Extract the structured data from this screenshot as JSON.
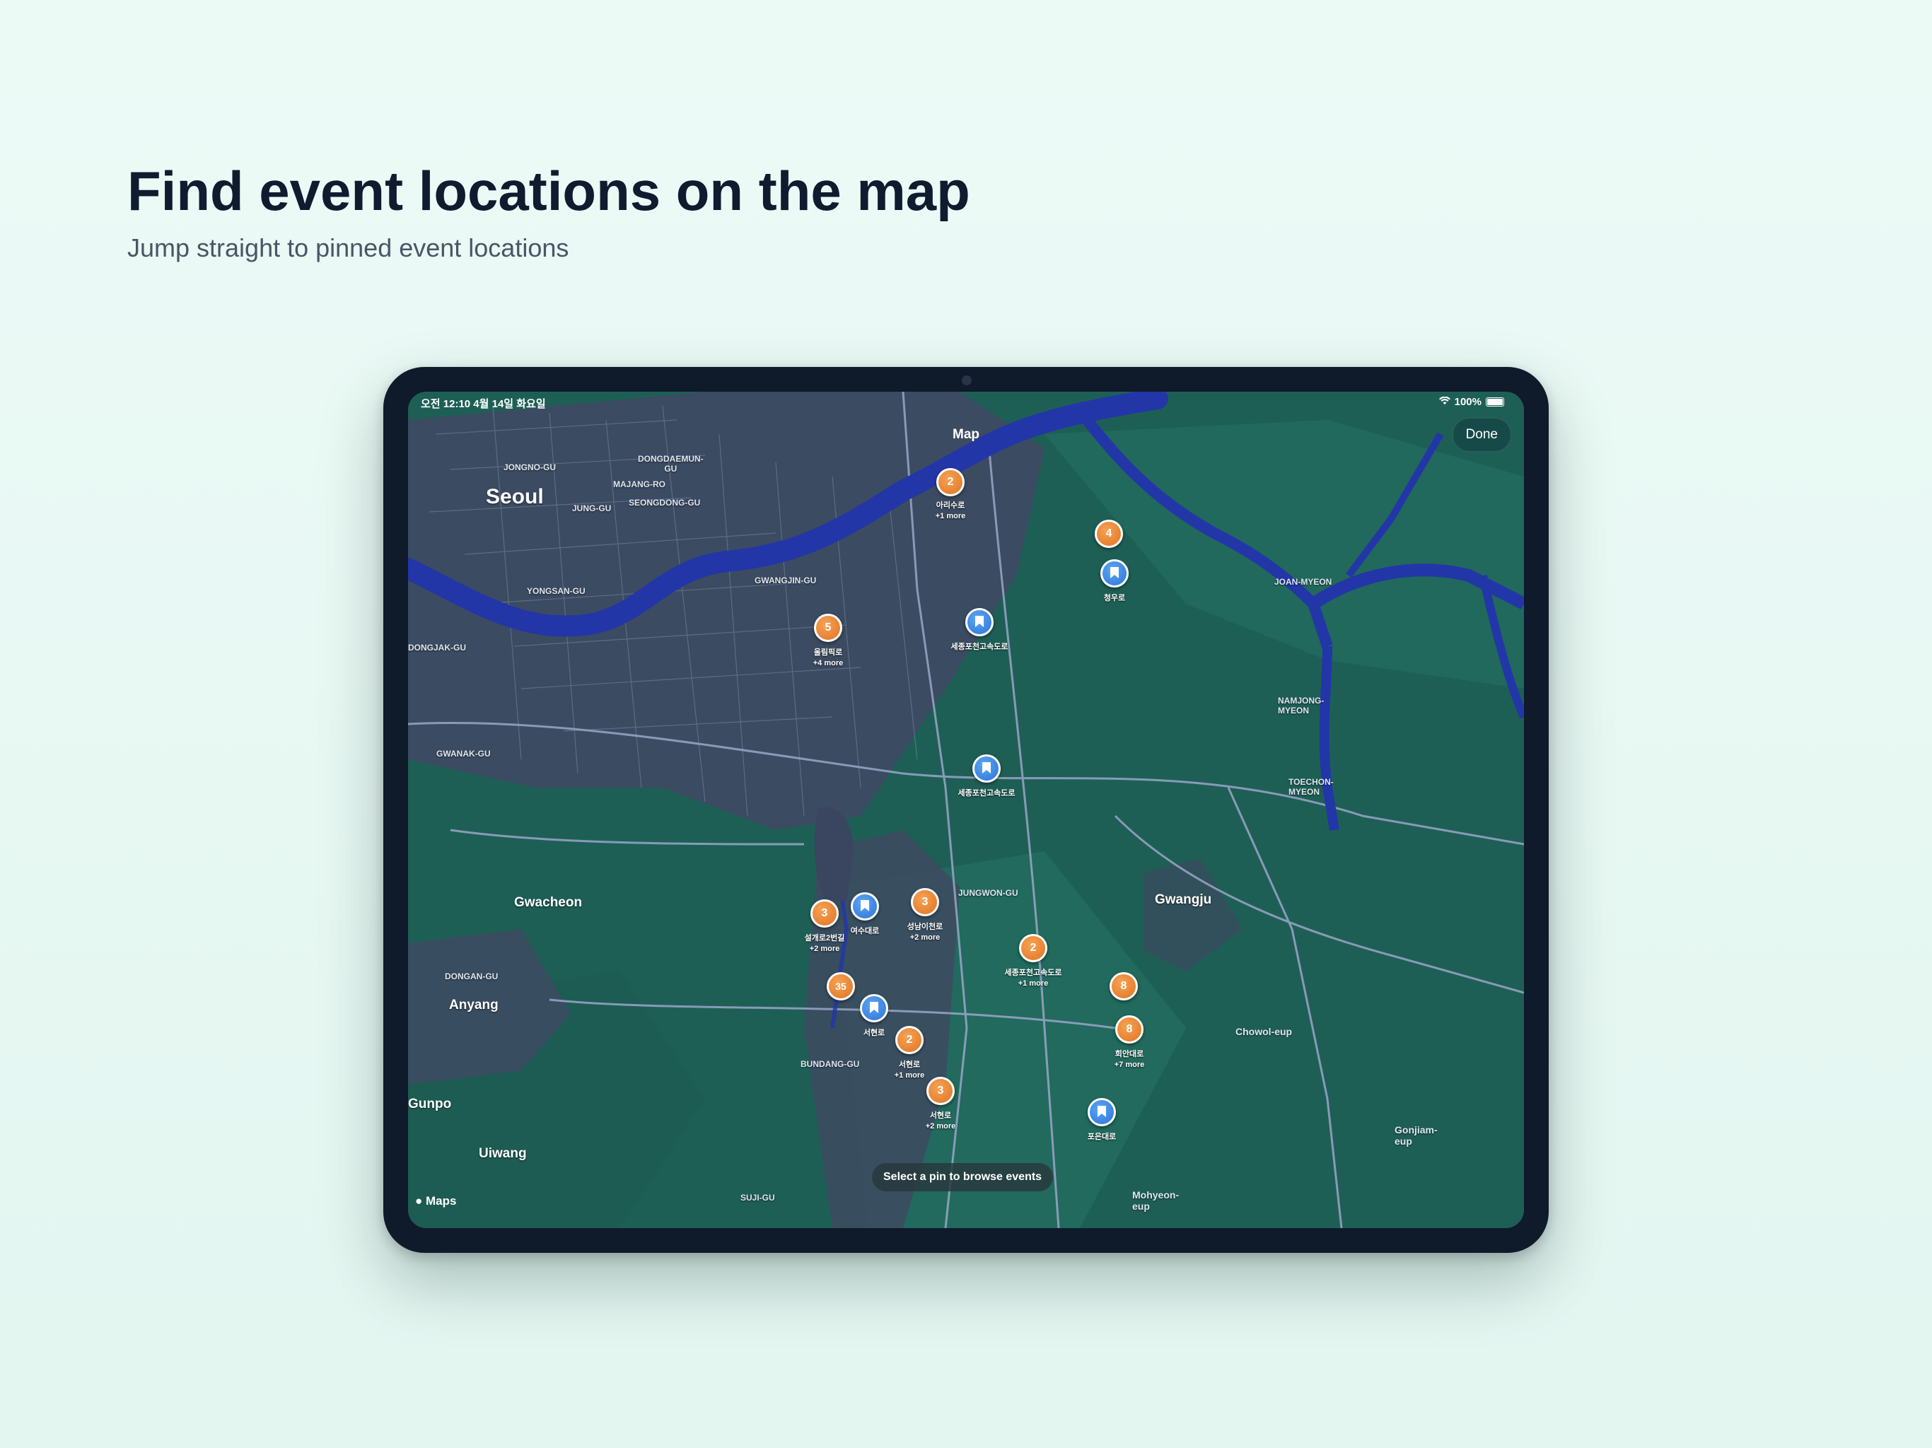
{
  "hero": {
    "title": "Find event locations on the map",
    "subtitle": "Jump straight to pinned event locations"
  },
  "status_bar": {
    "time_date": "오전 12:10   4월 14일 화요일",
    "battery": "100%"
  },
  "nav": {
    "title": "Map",
    "done_label": "Done"
  },
  "hint": "Select a pin to browse events",
  "attribution": "Maps",
  "map_labels": {
    "seoul": "Seoul",
    "gwacheon": "Gwacheon",
    "anyang": "Anyang",
    "gunpo": "Gunpo",
    "uiwang": "Uiwang",
    "gwangju": "Gwangju",
    "chowol": "Chowol-eup",
    "gonjiam": "Gonjiam-\neup",
    "mohyeon": "Mohyeon-\neup",
    "namjong": "NAMJONG-\nMYEON",
    "toechon": "TOECHON-\nMYEON",
    "joan": "JOAN-MYEON",
    "jongno": "JONGNO-GU",
    "jung": "JUNG-GU",
    "seongdong": "SEONGDONG-GU",
    "yongsan": "YONGSAN-GU",
    "gwangjin": "GWANGJIN-GU",
    "dongjak": "DONGJAK-GU",
    "gwanak": "GWANAK-GU",
    "jungwon": "JUNGWON-GU",
    "bundang": "BUNDANG-GU",
    "dongan": "DONGAN-GU",
    "suji": "SUJI-GU",
    "dongdaemun": "DONGDAEMUN-\nGU",
    "majang": "MAJANG-RO"
  },
  "clusters": [
    {
      "count": "2",
      "label": "아리수로",
      "more": "+1 more"
    },
    {
      "count": "4",
      "label": "",
      "more": ""
    },
    {
      "count": "5",
      "label": "올림픽로",
      "more": "+4 more"
    },
    {
      "count": "3",
      "label": "성남이천로",
      "more": "+2 more"
    },
    {
      "count": "3",
      "label": "설개로2번길",
      "more": "+2 more"
    },
    {
      "count": "2",
      "label": "세종포천고속도로",
      "more": "+1 more"
    },
    {
      "count": "35",
      "label": "",
      "more": ""
    },
    {
      "count": "8",
      "label": "",
      "more": ""
    },
    {
      "count": "8",
      "label": "회안대로",
      "more": "+7 more"
    },
    {
      "count": "2",
      "label": "서현로",
      "more": "+1 more"
    },
    {
      "count": "3",
      "label": "서현로",
      "more": "+2 more"
    }
  ],
  "pins": [
    {
      "label": "청우로"
    },
    {
      "label": "세종포천고속도로"
    },
    {
      "label": "세종포천고속도로"
    },
    {
      "label": "여수대로"
    },
    {
      "label": "서현로"
    },
    {
      "label": "포은대로"
    }
  ]
}
